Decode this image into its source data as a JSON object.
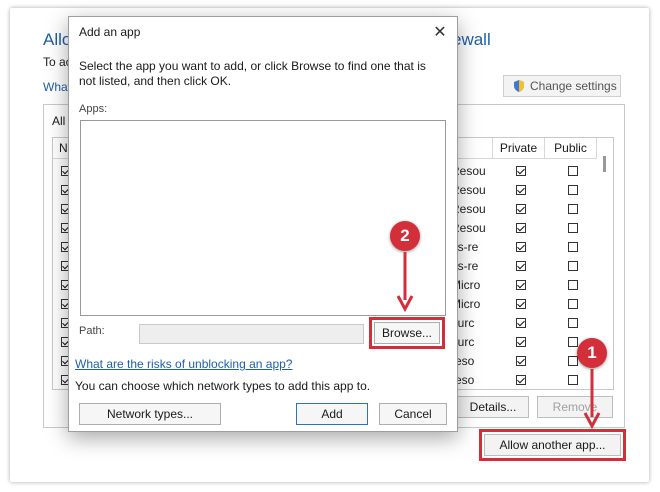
{
  "background": {
    "title_left": "Allo",
    "title_right": "ewall",
    "subtitle": "To ac",
    "link": "What",
    "change_settings": "Change settings",
    "group_label": "All",
    "columns": {
      "name": "N",
      "private": "Private",
      "public": "Public"
    },
    "rows": [
      {
        "text": "Resou"
      },
      {
        "text": "Resou"
      },
      {
        "text": "Resou"
      },
      {
        "text": "Resou"
      },
      {
        "text": "ns-re"
      },
      {
        "text": "ns-re"
      },
      {
        "text": "Micro"
      },
      {
        "text": "Micro"
      },
      {
        "text": "ourc"
      },
      {
        "text": "ourc"
      },
      {
        "text": "reso"
      },
      {
        "text": "reso"
      }
    ],
    "details_button": "Details...",
    "remove_button": "Remove",
    "allow_button": "Allow another app..."
  },
  "dialog": {
    "title": "Add an app",
    "close_glyph": "✕",
    "description": "Select the app you want to add, or click Browse to find one that is not listed, and then click OK.",
    "apps_label": "Apps:",
    "path_label": "Path:",
    "path_value": "",
    "browse_button": "Browse...",
    "risk_link": "What are the risks of unblocking an app?",
    "network_text": "You can choose which network types to add this app to.",
    "network_types_button": "Network types...",
    "add_button": "Add",
    "cancel_button": "Cancel"
  },
  "annotations": {
    "step_1": "1",
    "step_2": "2"
  },
  "colors": {
    "accent_red": "#d32f3a",
    "link_blue": "#1f5fa8"
  }
}
